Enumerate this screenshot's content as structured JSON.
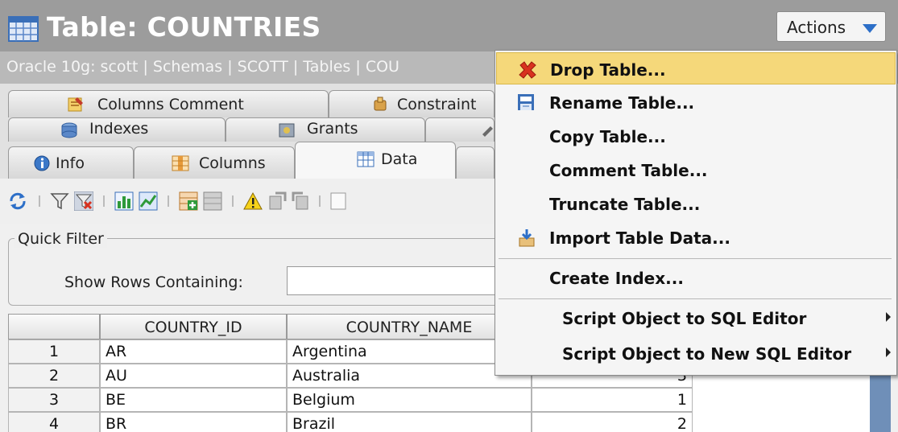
{
  "title": "Table: COUNTRIES",
  "actions_label": "Actions",
  "breadcrumb": "Oracle 10g: scott | Schemas | SCOTT | Tables | COU",
  "tabs_row1": [
    "Columns Comment",
    "Constraint"
  ],
  "tabs_row2": [
    "Indexes",
    "Grants"
  ],
  "tabs_row3": [
    "Info",
    "Columns",
    "Data"
  ],
  "quick_filter": {
    "title": "Quick Filter",
    "label": "Show Rows Containing:",
    "value": ""
  },
  "grid": {
    "columns": [
      "COUNTRY_ID",
      "COUNTRY_NAME"
    ],
    "rows": [
      {
        "num": "1",
        "id": "AR",
        "name": "Argentina",
        "extra": ""
      },
      {
        "num": "2",
        "id": "AU",
        "name": "Australia",
        "extra": "3"
      },
      {
        "num": "3",
        "id": "BE",
        "name": "Belgium",
        "extra": "1"
      },
      {
        "num": "4",
        "id": "BR",
        "name": "Brazil",
        "extra": "2"
      }
    ]
  },
  "menu": {
    "drop": "Drop Table...",
    "rename": "Rename Table...",
    "copy": "Copy Table...",
    "comment": "Comment Table...",
    "truncate": "Truncate Table...",
    "import": "Import Table Data...",
    "create_index": "Create Index...",
    "script_sql": "Script Object to SQL Editor",
    "script_new_sql": "Script Object to New SQL Editor"
  },
  "colors": {
    "accent_blue": "#2d6fc8",
    "highlight": "#f5d87a",
    "drop_red": "#d8321f"
  }
}
